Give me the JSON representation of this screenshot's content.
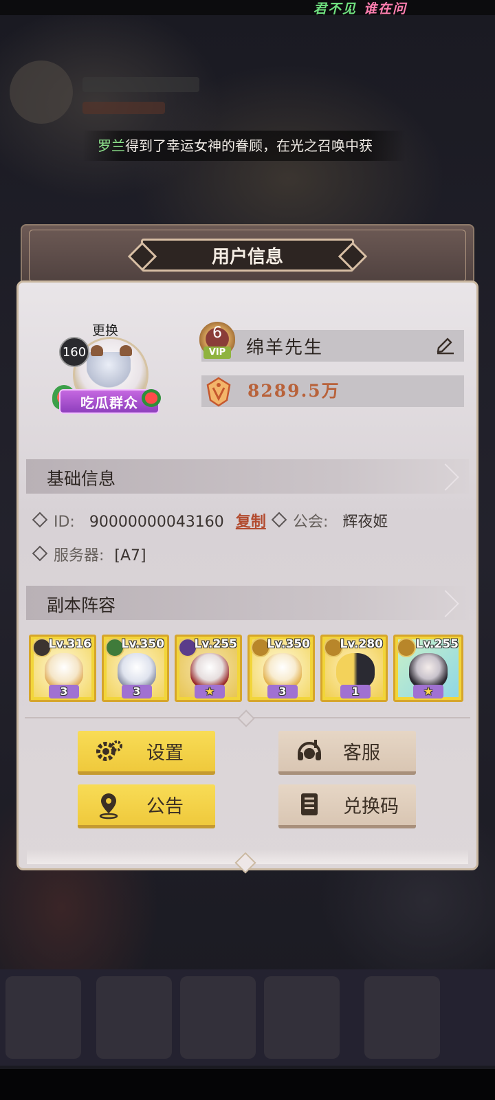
{
  "topbar": {
    "slogan_a": "君不见",
    "slogan_b": "谁在问"
  },
  "marquee": {
    "player_name": "罗兰",
    "message": "得到了幸运女神的眷顾，在光之召唤中获"
  },
  "panel": {
    "title": "用户信息"
  },
  "profile": {
    "change_label": "更换",
    "level": "160",
    "title_badge": "吃瓜群众",
    "vip_level": "6",
    "vip_tag": "VIP",
    "nickname": "绵羊先生",
    "gold": "8289.5万"
  },
  "basic_info": {
    "header": "基础信息",
    "id_label": "ID:",
    "id_value": "90000000043160",
    "copy_label": "复制",
    "guild_label": "公会:",
    "guild_value": "辉夜姬",
    "server_label": "服务器:",
    "server_value": "[A7]"
  },
  "lineup": {
    "header": "副本阵容",
    "heroes": [
      {
        "level": "Lv.316",
        "stars": "3"
      },
      {
        "level": "Lv.350",
        "stars": "3"
      },
      {
        "level": "Lv.255",
        "stars": "★"
      },
      {
        "level": "Lv.350",
        "stars": "3"
      },
      {
        "level": "Lv.280",
        "stars": "1"
      },
      {
        "level": "Lv.255",
        "stars": "★"
      }
    ]
  },
  "buttons": {
    "settings": "设置",
    "support": "客服",
    "notice": "公告",
    "redeem": "兑换码"
  },
  "colors": {
    "yellow_button": "#efc93c",
    "beige_button": "#d9c6b3",
    "gold_text": "#b8623a",
    "copy_link": "#b24a2e"
  }
}
